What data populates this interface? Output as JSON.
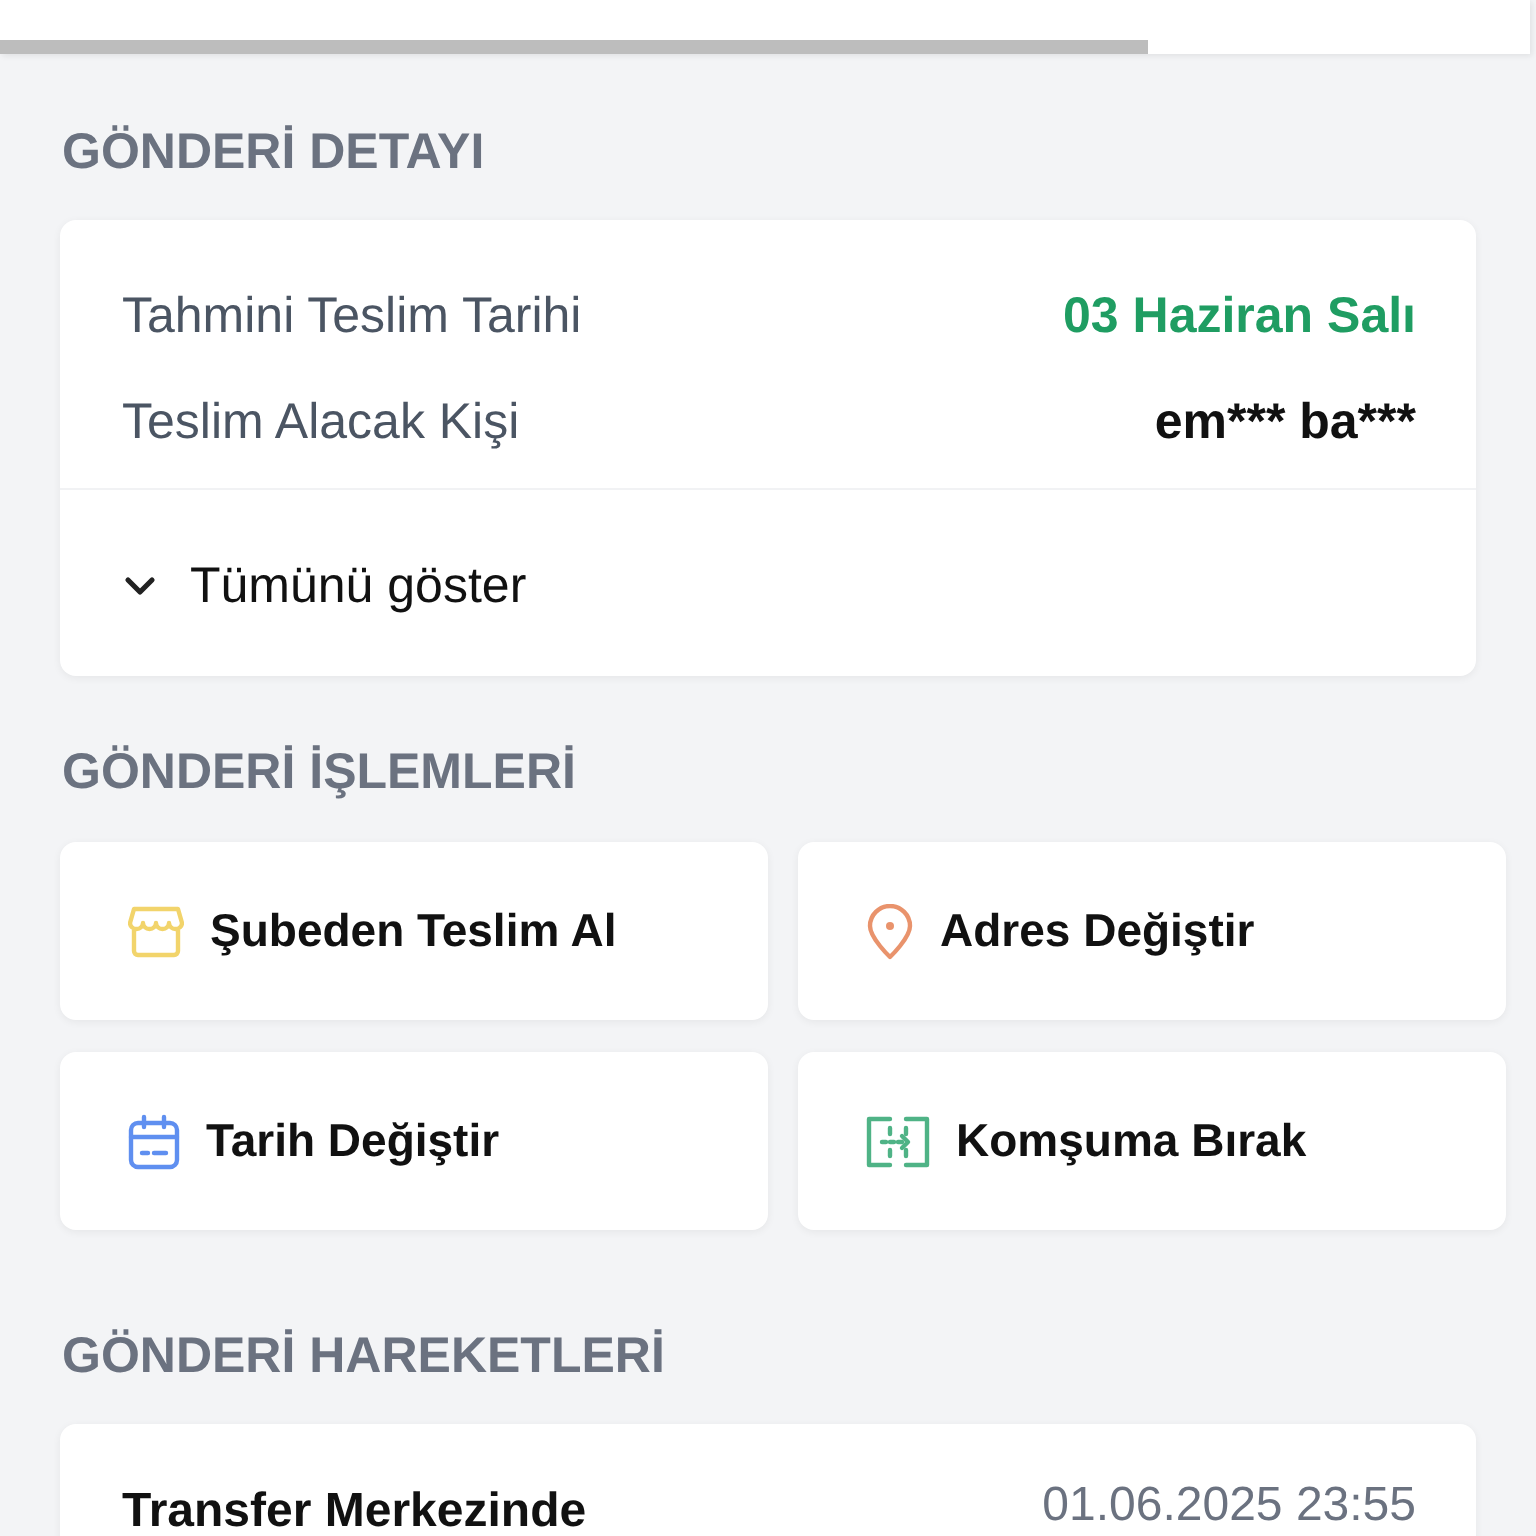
{
  "header": {
    "progress": {
      "level": 0.75
    }
  },
  "shipment_detail": {
    "title": "GÖNDERİ DETAYI",
    "rows": [
      {
        "label": "Tahmini Teslim Tarihi",
        "value": "03 Haziran Salı",
        "kind": "highlight"
      },
      {
        "label": "Teslim Alacak Kişi",
        "value": "em*** ba***",
        "kind": "plain"
      }
    ],
    "toggle": {
      "label": "Tümünü göster",
      "expanded": false
    }
  },
  "shipment_actions": {
    "title": "GÖNDERİ İŞLEMLERİ",
    "items": [
      {
        "label": "Şubeden Teslim Al",
        "kind": "store",
        "color": "#f2d46b"
      },
      {
        "label": "Adres Değiştir",
        "kind": "pin",
        "color": "#e9936c"
      },
      {
        "label": "Tarih Değiştir",
        "kind": "calendar",
        "color": "#5f8ff0"
      },
      {
        "label": "Komşuma Bırak",
        "kind": "handover",
        "color": "#4fb386"
      }
    ]
  },
  "shipment_movements": {
    "title": "GÖNDERİ HAREKETLERİ",
    "items": [
      {
        "status": "Transfer Merkezinde",
        "time": "01.06.2025 23:55"
      }
    ]
  }
}
